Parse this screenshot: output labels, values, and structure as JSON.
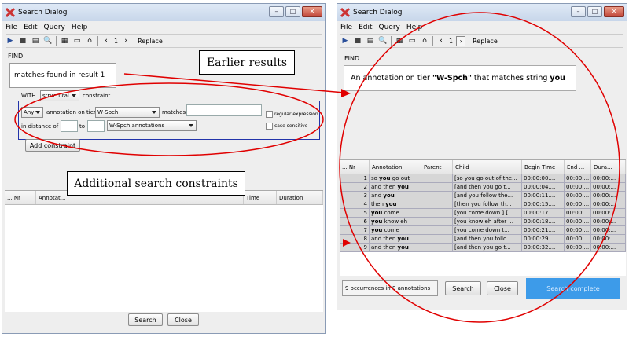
{
  "left_window": {
    "title": "Search Dialog",
    "menu": [
      "File",
      "Edit",
      "Query",
      "Help"
    ],
    "toolbar": {
      "page": "1",
      "replace_label": "Replace"
    },
    "find_label": "FIND",
    "find_text": "matches found in result 1",
    "with_label": "WITH",
    "structural_option": "structural",
    "constraint_label": "constraint",
    "constraint_row1": {
      "any_option": "Any",
      "annotation_on_tier_label": "annotation on tier",
      "tier_option": "W-Spch",
      "matches_label": "matches",
      "regex_label": "regular expression"
    },
    "constraint_row2": {
      "in_distance_label": "in distance of",
      "to_label": "to",
      "annotations_option": "W-Spch annotations",
      "case_label": "case sensitive"
    },
    "add_constraint_label": "Add constraint",
    "result_columns": [
      "... Nr",
      "Annotat...",
      "Time",
      "Duration"
    ],
    "search_label": "Search",
    "close_label": "Close"
  },
  "right_window": {
    "title": "Search Dialog",
    "menu": [
      "File",
      "Edit",
      "Query",
      "Help"
    ],
    "toolbar": {
      "page": "1",
      "replace_label": "Replace"
    },
    "find_label": "FIND",
    "query_prefix": "An annotation on tier ",
    "query_tier": "\"W-Spch\"",
    "query_middle": " that matches string ",
    "query_string": "you",
    "columns": [
      "... Nr",
      "Annotation",
      "Parent",
      "Child",
      "Begin Time",
      "End ...",
      "Dura..."
    ],
    "rows": [
      {
        "nr": "1",
        "pre": "so ",
        "hit": "you",
        "post": " go out",
        "child": "[so you go out of the...",
        "begin": "00:00:00....",
        "end": "00:00:...",
        "dur": "00:00:..."
      },
      {
        "nr": "2",
        "pre": "and then ",
        "hit": "you",
        "post": "",
        "child": "[and then you go t...",
        "begin": "00:00:04....",
        "end": "00:00:...",
        "dur": "00:00:..."
      },
      {
        "nr": "3",
        "pre": "and ",
        "hit": "you",
        "post": "",
        "child": "[and you follow the...",
        "begin": "00:00:11....",
        "end": "00:00:...",
        "dur": "00:00:..."
      },
      {
        "nr": "4",
        "pre": "then ",
        "hit": "you",
        "post": "",
        "child": "[then you follow th...",
        "begin": "00:00:15....",
        "end": "00:00:...",
        "dur": "00:00:..."
      },
      {
        "nr": "5",
        "pre": "",
        "hit": "you",
        "post": " come",
        "child": "[you come down ] [...",
        "begin": "00:00:17....",
        "end": "00:00:...",
        "dur": "00:00:..."
      },
      {
        "nr": "6",
        "pre": "",
        "hit": "you",
        "post": " know eh",
        "child": "[you know eh after ...",
        "begin": "00:00:18....",
        "end": "00:00:...",
        "dur": "00:00:..."
      },
      {
        "nr": "7",
        "pre": "",
        "hit": "you",
        "post": " come",
        "child": "[you come down t...",
        "begin": "00:00:21....",
        "end": "00:00:...",
        "dur": "00:00:..."
      },
      {
        "nr": "8",
        "pre": "and then ",
        "hit": "you",
        "post": "",
        "child": "[and then you follo...",
        "begin": "00:00:29....",
        "end": "00:00:...",
        "dur": "00:00:..."
      },
      {
        "nr": "9",
        "pre": "and then ",
        "hit": "you",
        "post": "",
        "child": "[and then you go t...",
        "begin": "00:00:32....",
        "end": "00:00:...",
        "dur": "00:00:..."
      }
    ],
    "occurrences": "9 occurrences in 9 annotations",
    "search_label": "Search",
    "close_label": "Close",
    "status": "Search complete"
  },
  "callouts": {
    "earlier": "Earlier results",
    "additional": "Additional search constraints"
  },
  "colors": {
    "annotation_red": "#e00000",
    "status_blue": "#3d9be9"
  }
}
